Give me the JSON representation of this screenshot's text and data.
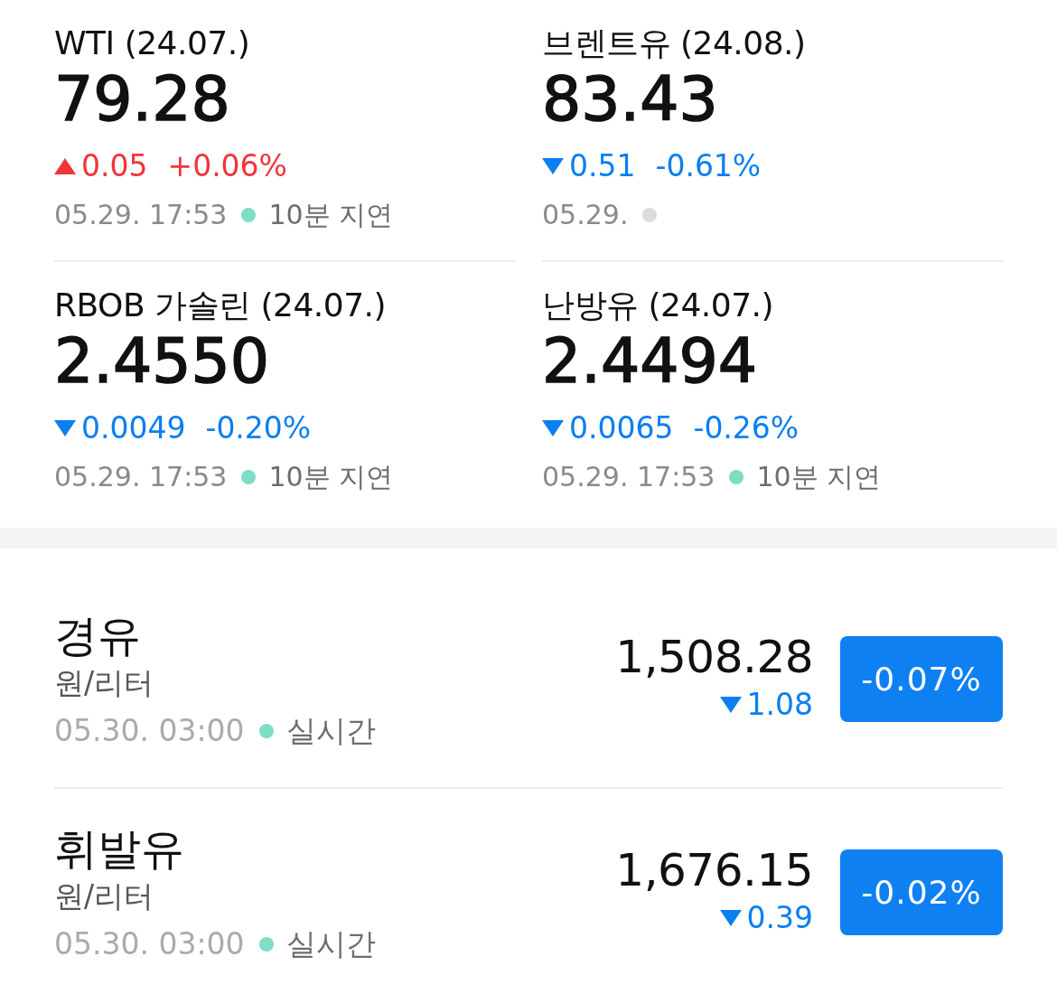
{
  "futures": [
    {
      "name": "WTI (24.07.)",
      "value": "79.28",
      "kind": "up",
      "change": "0.05",
      "percent": "+0.06%",
      "time": "05.29. 17:53",
      "status": {
        "color": "#7fdcc5",
        "label": "10분 지연"
      }
    },
    {
      "name": "브렌트유 (24.08.)",
      "value": "83.43",
      "kind": "down",
      "change": "0.51",
      "percent": "-0.61%",
      "time": "05.29.",
      "status": {
        "color": "#dcdcdc"
      }
    },
    {
      "name": "RBOB 가솔린 (24.07.)",
      "value": "2.4550",
      "kind": "down",
      "change": "0.0049",
      "percent": "-0.20%",
      "time": "05.29. 17:53",
      "status": {
        "color": "#7fdcc5",
        "label": "10분 지연"
      }
    },
    {
      "name": "난방유 (24.07.)",
      "value": "2.4494",
      "kind": "down",
      "change": "0.0065",
      "percent": "-0.26%",
      "time": "05.29. 17:53",
      "status": {
        "color": "#7fdcc5",
        "label": "10분 지연"
      }
    }
  ],
  "fuels": [
    {
      "name": "경유",
      "unit": "원/리터",
      "time": "05.30. 03:00",
      "status": {
        "color": "#7fdcc5",
        "label": "실시간"
      },
      "price": "1,508.28",
      "kind": "down",
      "change": "1.08",
      "percent": "-0.07%"
    },
    {
      "name": "휘발유",
      "unit": "원/리터",
      "time": "05.30. 03:00",
      "status": {
        "color": "#7fdcc5",
        "label": "실시간"
      },
      "price": "1,676.15",
      "kind": "down",
      "change": "0.39",
      "percent": "-0.02%"
    }
  ]
}
